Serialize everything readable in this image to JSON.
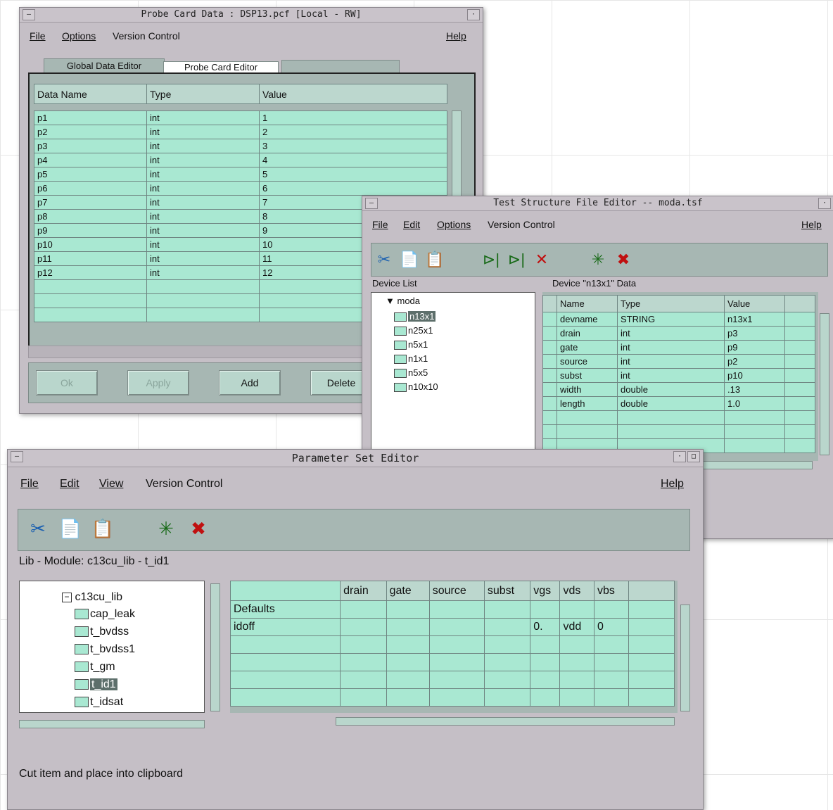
{
  "probe_window": {
    "title": "Probe Card Data : DSP13.pcf [Local - RW]",
    "menu": [
      "File",
      "Options",
      "Version Control"
    ],
    "help": "Help",
    "tabs": [
      "Global Data Editor",
      "Probe Card Editor"
    ],
    "columns": [
      "Data Name",
      "Type",
      "Value"
    ],
    "rows": [
      [
        "p1",
        "int",
        "1"
      ],
      [
        "p2",
        "int",
        "2"
      ],
      [
        "p3",
        "int",
        "3"
      ],
      [
        "p4",
        "int",
        "4"
      ],
      [
        "p5",
        "int",
        "5"
      ],
      [
        "p6",
        "int",
        "6"
      ],
      [
        "p7",
        "int",
        "7"
      ],
      [
        "p8",
        "int",
        "8"
      ],
      [
        "p9",
        "int",
        "9"
      ],
      [
        "p10",
        "int",
        "10"
      ],
      [
        "p11",
        "int",
        "11"
      ],
      [
        "p12",
        "int",
        "12"
      ]
    ],
    "buttons": {
      "ok": "Ok",
      "apply": "Apply",
      "add": "Add",
      "delete": "Delete"
    }
  },
  "tsf_window": {
    "title": "Test Structure File Editor -- moda.tsf",
    "menu": [
      "File",
      "Edit",
      "Options",
      "Version Control"
    ],
    "help": "Help",
    "device_list_label": "Device List",
    "data_label": "Device \"n13x1\" Data",
    "tree": {
      "root": "moda",
      "items": [
        "n13x1",
        "n25x1",
        "n5x1",
        "n1x1",
        "n5x5",
        "n10x10"
      ],
      "selected": "n13x1"
    },
    "columns": [
      "Name",
      "Type",
      "Value"
    ],
    "rows": [
      [
        "devname",
        "STRING",
        "n13x1"
      ],
      [
        "drain",
        "int",
        "p3"
      ],
      [
        "gate",
        "int",
        "p9"
      ],
      [
        "source",
        "int",
        "p2"
      ],
      [
        "subst",
        "int",
        "p10"
      ],
      [
        "width",
        "double",
        ".13"
      ],
      [
        "length",
        "double",
        "1.0"
      ]
    ]
  },
  "pse_window": {
    "title": "Parameter Set Editor",
    "menu": [
      "File",
      "Edit",
      "View",
      "Version Control"
    ],
    "help": "Help",
    "lib_module": "Lib - Module: c13cu_lib - t_id1",
    "tree": {
      "lib": "c13cu_lib",
      "items": [
        "cap_leak",
        "t_bvdss",
        "t_bvdss1",
        "t_gm",
        "t_id1",
        "t_idsat"
      ],
      "selected": "t_id1"
    },
    "columns": [
      "drain",
      "gate",
      "source",
      "subst",
      "vgs",
      "vds",
      "vbs"
    ],
    "rows": [
      {
        "label": "Defaults",
        "values": [
          "",
          "",
          "",
          "",
          "",
          "",
          ""
        ]
      },
      {
        "label": "idoff",
        "values": [
          "",
          "",
          "",
          "",
          "0.",
          "vdd",
          "0"
        ]
      }
    ],
    "status": "Cut item and place into clipboard"
  }
}
